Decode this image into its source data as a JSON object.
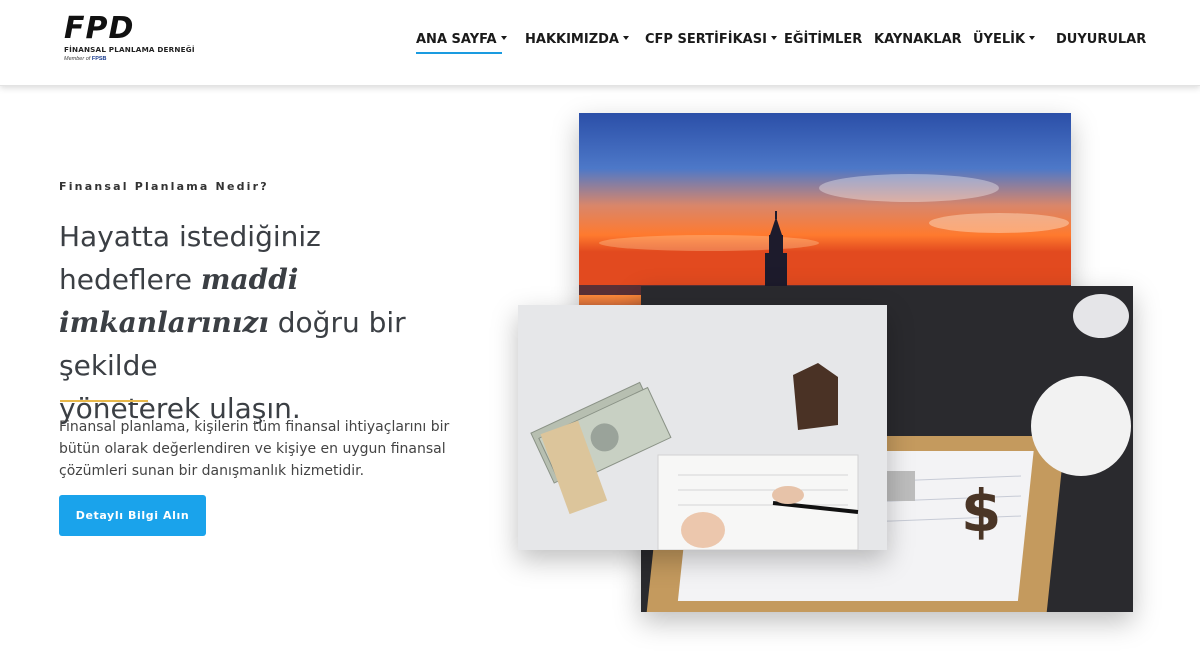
{
  "header": {
    "logo": {
      "mark": "FPD",
      "subtitle": "FİNANSAL PLANLAMA DERNEĞİ",
      "member_prefix": "Member of",
      "member_org": "FPSB"
    },
    "nav": [
      {
        "label": "ANA SAYFA",
        "dropdown": true,
        "active": true
      },
      {
        "label": "HAKKIMIZDA",
        "dropdown": true,
        "active": false
      },
      {
        "label": "CFP SERTİFİKASI",
        "dropdown": true,
        "active": false
      },
      {
        "label": "EĞİTİMLER",
        "dropdown": false,
        "active": false
      },
      {
        "label": "KAYNAKLAR",
        "dropdown": false,
        "active": false
      },
      {
        "label": "ÜYELİK",
        "dropdown": true,
        "active": false
      },
      {
        "label": "DUYURULAR",
        "dropdown": false,
        "active": false
      }
    ]
  },
  "hero": {
    "eyebrow": "Finansal Planlama Nedir?",
    "headline": {
      "line1": "Hayatta istediğiniz",
      "line2_pre": "hedeflere ",
      "line2_em": "maddi",
      "line3_em": "imkanlarınızı",
      "line3_post": " doğru bir şekilde",
      "line4": "yöneterek ulaşın."
    },
    "description": "Finansal planlama, kişilerin tüm finansal ihtiyaçlarını bir bütün olarak değerlendiren ve kişiye en uygun finansal çözümleri sunan bir danışmanlık hizmetidir.",
    "cta_label": "Detaylı Bilgi Alın"
  },
  "colors": {
    "accent": "#1aa3eb",
    "nav_underline": "#1a9be0",
    "divider": "#e8b84a",
    "text": "#3b3f44"
  },
  "images": [
    {
      "name": "maidens-tower-sunset-photo"
    },
    {
      "name": "desk-planning-photo"
    },
    {
      "name": "money-and-signing-photo"
    }
  ]
}
